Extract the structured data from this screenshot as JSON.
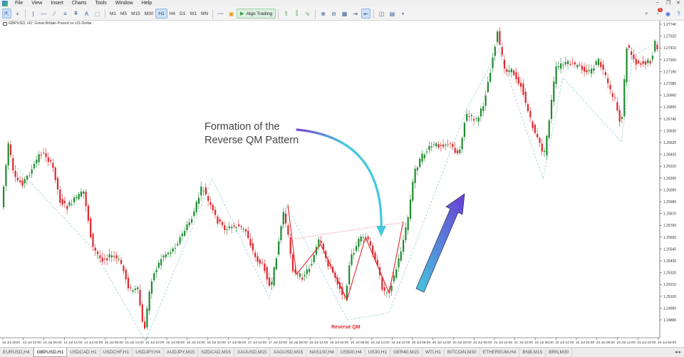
{
  "menu": [
    "File",
    "View",
    "Insert",
    "Charts",
    "Tools",
    "Window",
    "Help"
  ],
  "toolbar": {
    "timeframes": [
      "M1",
      "M5",
      "M15",
      "M30",
      "H1",
      "H4",
      "D1",
      "W1",
      "MN"
    ],
    "active_timeframe": "H1",
    "algo_label": "Algo Trading",
    "notification_count": "1"
  },
  "chart": {
    "title": "GBPUSD, H1:  Great Britain Pound vs US Dollar",
    "annotation": [
      "Formation of the",
      "Reverse QM Pattern"
    ],
    "pattern_label": "Reverse QM",
    "price_labels": [
      "1.27740",
      "1.27520",
      "1.27410",
      "1.27300",
      "1.27190",
      "1.27080",
      "1.26960",
      "1.26850",
      "1.26740",
      "1.26630",
      "1.26520",
      "1.26420",
      "1.26310",
      "1.26200",
      "1.26090",
      "1.25980",
      "1.25870",
      "1.25760",
      "1.25650",
      "1.25540",
      "1.25430",
      "1.25320",
      "1.25210",
      "1.25100",
      "1.24990",
      "1.24880"
    ],
    "time_labels": [
      "10 Jul 2023",
      "13 Jul 22:00",
      "14 Jul 06:00",
      "14 Jul 14:00",
      "14 Jul 22:00",
      "15 Jul 06:00",
      "15 Jul 14:00",
      "15 Jul 22:00",
      "16 Jul 06:00",
      "16 Jul 14:00",
      "16 Jul 22:00",
      "17 Jul 06:00",
      "17 Jul 14:00",
      "17 Jul 22:00",
      "18 Jul 06:00",
      "18 Jul 14:00",
      "18 Jul 22:00",
      "19 Jul 06:00",
      "19 Jul 14:00",
      "19 Jul 22:00",
      "20 Jul 06:00",
      "20 Jul 14:00",
      "20 Jul 22:00",
      "21 Jul 06:00",
      "21 Jul 14:00",
      "21 Jul 22:00",
      "22 Jul 06:00",
      "22 Jul 14:00",
      "22 Jul 22:00",
      "23 Jul 06:00",
      "23 Jul 14:00",
      "23 Jul 22:00",
      "24 Jul 06:00"
    ]
  },
  "tabs": [
    "EURUSD,H4",
    "GBPUSD,H1",
    "USDCAD,H1",
    "USDCHF,H1",
    "USDJPY,H4",
    "AUDJPY,M15",
    "NZDCAD,M15",
    "XAUUSD,M15",
    "XAGUSD,M15",
    "NAS100,H4",
    "US500,H4",
    "US30,H1",
    "GER40,M15",
    "WTI,H1",
    "BITCOIN,M30",
    "ETHEREUM,H4",
    "BNB,M15",
    "BRN,M30"
  ],
  "active_tab": "GBPUSD,H1",
  "colors": {
    "bull": "#1f8a2f",
    "bear": "#e0262c",
    "arrow_cyan": "#45c8de",
    "arrow_purple": "#6a3dd4",
    "pattern_red": "#e0262c"
  }
}
